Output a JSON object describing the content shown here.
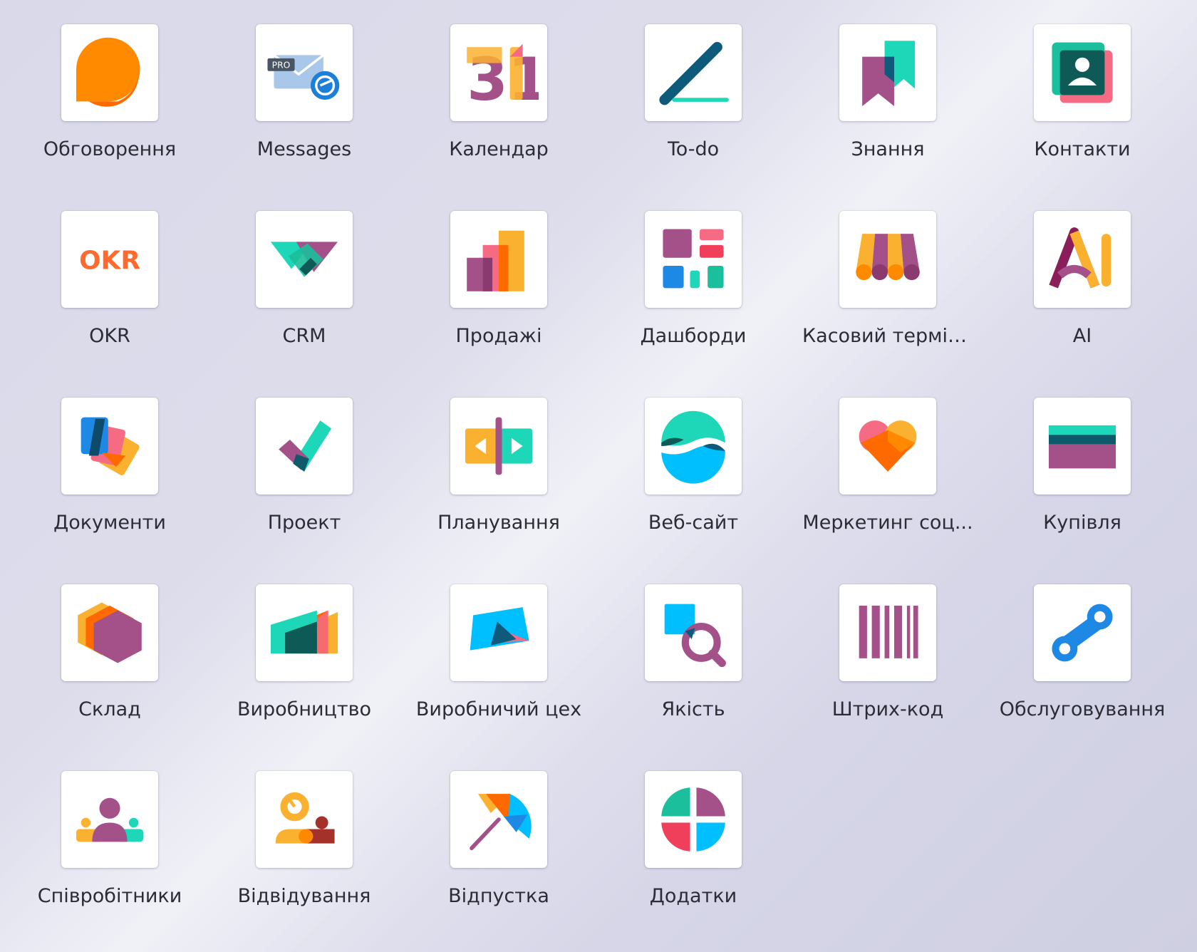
{
  "apps": [
    {
      "label": "Обговорення",
      "icon": "discuss-icon"
    },
    {
      "label": "Messages",
      "icon": "messages-pro-icon",
      "badge": "PRO"
    },
    {
      "label": "Календар",
      "icon": "calendar-icon",
      "day": "31"
    },
    {
      "label": "To-do",
      "icon": "todo-icon"
    },
    {
      "label": "Знання",
      "icon": "knowledge-icon"
    },
    {
      "label": "Контакти",
      "icon": "contacts-icon"
    },
    {
      "label": "OKR",
      "icon": "okr-icon",
      "logo_text": "OKR"
    },
    {
      "label": "CRM",
      "icon": "crm-icon"
    },
    {
      "label": "Продажі",
      "icon": "sales-icon"
    },
    {
      "label": "Дашборди",
      "icon": "dashboards-icon"
    },
    {
      "label": "Касовий термін...",
      "icon": "pos-icon"
    },
    {
      "label": "AI",
      "icon": "ai-icon"
    },
    {
      "label": "Документи",
      "icon": "documents-icon"
    },
    {
      "label": "Проект",
      "icon": "project-icon"
    },
    {
      "label": "Планування",
      "icon": "planning-icon"
    },
    {
      "label": "Веб-сайт",
      "icon": "website-icon"
    },
    {
      "label": "Меркетинг соц...",
      "icon": "social-marketing-icon"
    },
    {
      "label": "Купівля",
      "icon": "purchase-icon"
    },
    {
      "label": "Склад",
      "icon": "inventory-icon"
    },
    {
      "label": "Виробництво",
      "icon": "manufacturing-icon"
    },
    {
      "label": "Виробничий цех",
      "icon": "shop-floor-icon"
    },
    {
      "label": "Якість",
      "icon": "quality-icon"
    },
    {
      "label": "Штрих-код",
      "icon": "barcode-icon"
    },
    {
      "label": "Обслуговування",
      "icon": "maintenance-icon"
    },
    {
      "label": "Співробітники",
      "icon": "employees-icon"
    },
    {
      "label": "Відвідування",
      "icon": "attendances-icon"
    },
    {
      "label": "Відпустка",
      "icon": "time-off-icon"
    },
    {
      "label": "Додатки",
      "icon": "apps-icon"
    }
  ]
}
